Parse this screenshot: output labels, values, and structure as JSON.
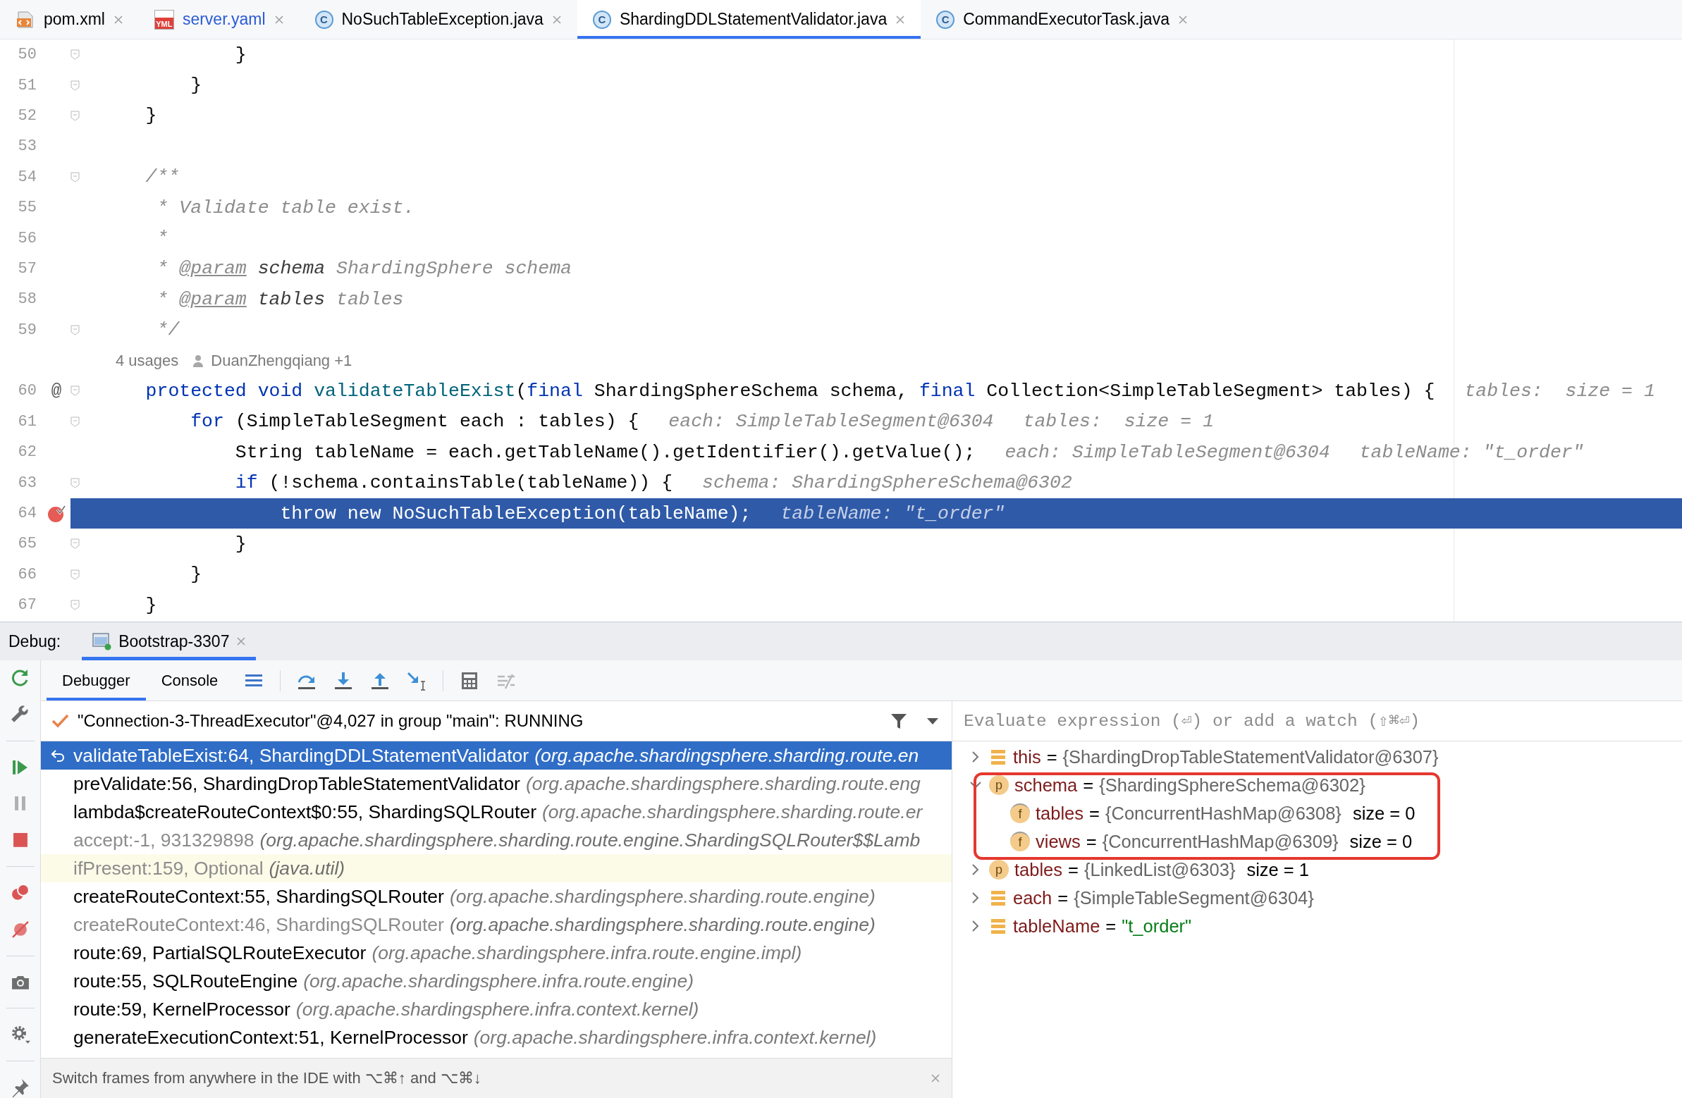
{
  "tabs": [
    {
      "label": "pom.xml",
      "kind": "xml",
      "selected": false,
      "color": "#000000"
    },
    {
      "label": "server.yaml",
      "kind": "yaml",
      "icon_text": "YML",
      "selected": false,
      "color": "#2a5bd7"
    },
    {
      "label": "NoSuchTableException.java",
      "kind": "class",
      "icon_text": "C",
      "selected": false,
      "color": "#000000"
    },
    {
      "label": "ShardingDDLStatementValidator.java",
      "kind": "class",
      "icon_text": "C",
      "selected": true,
      "color": "#000000"
    },
    {
      "label": "CommandExecutorTask.java",
      "kind": "class",
      "icon_text": "C",
      "selected": false,
      "color": "#000000"
    }
  ],
  "editor": {
    "lines": [
      {
        "kind": "code",
        "number": "50",
        "fold": true,
        "breakpoint": false,
        "current": false,
        "tokens": [
          {
            "kind": "plain",
            "text": "            }"
          }
        ]
      },
      {
        "kind": "code",
        "number": "51",
        "fold": true,
        "breakpoint": false,
        "current": false,
        "tokens": [
          {
            "kind": "plain",
            "text": "        }"
          }
        ]
      },
      {
        "kind": "code",
        "number": "52",
        "fold": true,
        "breakpoint": false,
        "current": false,
        "tokens": [
          {
            "kind": "plain",
            "text": "    }"
          }
        ]
      },
      {
        "kind": "code",
        "number": "53",
        "fold": false,
        "breakpoint": false,
        "current": false
      },
      {
        "kind": "code",
        "number": "54",
        "fold": true,
        "breakpoint": false,
        "current": false,
        "tokens": [
          {
            "kind": "comment",
            "text": "    /**"
          }
        ]
      },
      {
        "kind": "code",
        "number": "55",
        "fold": false,
        "breakpoint": false,
        "current": false,
        "tokens": [
          {
            "kind": "comment",
            "text": "     * Validate table exist."
          }
        ]
      },
      {
        "kind": "code",
        "number": "56",
        "fold": false,
        "breakpoint": false,
        "current": false,
        "tokens": [
          {
            "kind": "comment",
            "text": "     *"
          }
        ]
      },
      {
        "kind": "code",
        "number": "57",
        "fold": false,
        "breakpoint": false,
        "current": false,
        "tokens": [
          {
            "kind": "comment",
            "text": "     * "
          },
          {
            "kind": "doctag",
            "text": "@param"
          },
          {
            "kind": "docparam",
            "text": " schema"
          },
          {
            "kind": "comment",
            "text": " ShardingSphere schema"
          }
        ]
      },
      {
        "kind": "code",
        "number": "58",
        "fold": false,
        "breakpoint": false,
        "current": false,
        "tokens": [
          {
            "kind": "comment",
            "text": "     * "
          },
          {
            "kind": "doctag",
            "text": "@param"
          },
          {
            "kind": "docparam",
            "text": " tables"
          },
          {
            "kind": "comment",
            "text": " tables"
          }
        ]
      },
      {
        "kind": "code",
        "number": "59",
        "fold": true,
        "breakpoint": false,
        "current": false,
        "tokens": [
          {
            "kind": "comment",
            "text": "     */"
          }
        ]
      },
      {
        "kind": "inlay",
        "usages": "4 usages",
        "author": "DuanZhengqiang +1"
      },
      {
        "kind": "code",
        "number": "60",
        "gutter_text": "@",
        "fold": true,
        "breakpoint": false,
        "current": false,
        "tokens": [
          {
            "kind": "keyword",
            "text": "    protected void "
          },
          {
            "kind": "decl",
            "text": "validateTableExist"
          },
          {
            "kind": "plain",
            "text": "("
          },
          {
            "kind": "keyword",
            "text": "final"
          },
          {
            "kind": "plain",
            "text": " ShardingSphereSchema schema, "
          },
          {
            "kind": "keyword",
            "text": "final"
          },
          {
            "kind": "plain",
            "text": " Collection<SimpleTableSegment> tables) {"
          }
        ],
        "hints": [
          "tables:  size = 1"
        ]
      },
      {
        "kind": "code",
        "number": "61",
        "fold": true,
        "breakpoint": false,
        "current": false,
        "tokens": [
          {
            "kind": "keyword",
            "text": "        for"
          },
          {
            "kind": "plain",
            "text": " (SimpleTableSegment each : tables) {"
          }
        ],
        "hints": [
          "each: SimpleTableSegment@6304",
          "tables:  size = 1"
        ]
      },
      {
        "kind": "code",
        "number": "62",
        "fold": false,
        "breakpoint": false,
        "current": false,
        "tokens": [
          {
            "kind": "plain",
            "text": "            String tableName = each.getTableName().getIdentifier().getValue();"
          }
        ],
        "hints": [
          "each: SimpleTableSegment@6304",
          "tableName: \"t_order\""
        ]
      },
      {
        "kind": "code",
        "number": "63",
        "fold": true,
        "breakpoint": false,
        "current": false,
        "tokens": [
          {
            "kind": "keyword",
            "text": "            if"
          },
          {
            "kind": "plain",
            "text": " (!schema.containsTable(tableName)) {"
          }
        ],
        "hints": [
          "schema: ShardingSphereSchema@6302"
        ]
      },
      {
        "kind": "code",
        "number": "64",
        "fold": false,
        "breakpoint": true,
        "current": true,
        "tokens": [
          {
            "kind": "keyword",
            "text": "                throw new"
          },
          {
            "kind": "plain",
            "text": " NoSuchTableException(tableName);"
          }
        ],
        "hints": [
          "tableName: \"t_order\""
        ]
      },
      {
        "kind": "code",
        "number": "65",
        "fold": true,
        "breakpoint": false,
        "current": false,
        "tokens": [
          {
            "kind": "plain",
            "text": "            }"
          }
        ]
      },
      {
        "kind": "code",
        "number": "66",
        "fold": true,
        "breakpoint": false,
        "current": false,
        "tokens": [
          {
            "kind": "plain",
            "text": "        }"
          }
        ]
      },
      {
        "kind": "code",
        "number": "67",
        "fold": true,
        "breakpoint": false,
        "current": false,
        "tokens": [
          {
            "kind": "plain",
            "text": "    }"
          }
        ]
      }
    ]
  },
  "debug": {
    "label": "Debug:",
    "session": {
      "label": "Bootstrap-3307",
      "selected": true
    },
    "tabs": [
      {
        "label": "Debugger",
        "selected": true
      },
      {
        "label": "Console",
        "selected": false
      }
    ],
    "thread": "\"Connection-3-ThreadExecutor\"@4,027 in group \"main\": RUNNING",
    "frames": [
      {
        "method": "validateTableExist:64, ShardingDDLStatementValidator",
        "package": "(org.apache.shardingsphere.sharding.route.en",
        "selected": true,
        "kind": "normal"
      },
      {
        "method": "preValidate:56, ShardingDropTableStatementValidator",
        "package": "(org.apache.shardingsphere.sharding.route.eng",
        "selected": false,
        "kind": "normal"
      },
      {
        "method": "lambda$createRouteContext$0:55, ShardingSQLRouter",
        "package": "(org.apache.shardingsphere.sharding.route.er",
        "selected": false,
        "kind": "normal"
      },
      {
        "method": "accept:-1, 931329898",
        "package": "(org.apache.shardingsphere.sharding.route.engine.ShardingSQLRouter$$Lamb",
        "selected": false,
        "kind": "dimmed"
      },
      {
        "method": "ifPresent:159, Optional",
        "package": "(java.util)",
        "selected": false,
        "kind": "library"
      },
      {
        "method": "createRouteContext:55, ShardingSQLRouter",
        "package": "(org.apache.shardingsphere.sharding.route.engine)",
        "selected": false,
        "kind": "normal"
      },
      {
        "method": "createRouteContext:46, ShardingSQLRouter",
        "package": "(org.apache.shardingsphere.sharding.route.engine)",
        "selected": false,
        "kind": "dimmed"
      },
      {
        "method": "route:69, PartialSQLRouteExecutor",
        "package": "(org.apache.shardingsphere.infra.route.engine.impl)",
        "selected": false,
        "kind": "normal"
      },
      {
        "method": "route:55, SQLRouteEngine",
        "package": "(org.apache.shardingsphere.infra.route.engine)",
        "selected": false,
        "kind": "normal"
      },
      {
        "method": "route:59, KernelProcessor",
        "package": "(org.apache.shardingsphere.infra.context.kernel)",
        "selected": false,
        "kind": "normal"
      },
      {
        "method": "generateExecutionContext:51, KernelProcessor",
        "package": "(org.apache.shardingsphere.infra.context.kernel)",
        "selected": false,
        "kind": "normal"
      }
    ],
    "tip": "Switch frames from anywhere in the IDE with ⌥⌘↑ and ⌥⌘↓",
    "evaluate": {
      "placeholder": "Evaluate expression (⏎) or add a watch (⇧⌘⏎)"
    },
    "variables": [
      {
        "kind": "local",
        "name": "this",
        "separator": "=",
        "value": "{ShardingDropTableStatementValidator@6307}",
        "expanded": false
      },
      {
        "kind": "param",
        "badge": "p",
        "name": "schema",
        "separator": "=",
        "value": "{ShardingSphereSchema@6302}",
        "expanded": true,
        "annotated": true,
        "children": [
          {
            "kind": "field",
            "badge": "f",
            "name": "tables",
            "separator": "=",
            "value": "{ConcurrentHashMap@6308}",
            "extra": "size = 0"
          },
          {
            "kind": "field",
            "badge": "f",
            "name": "views",
            "separator": "=",
            "value": "{ConcurrentHashMap@6309}",
            "extra": "size = 0"
          }
        ]
      },
      {
        "kind": "param",
        "badge": "p",
        "name": "tables",
        "separator": "=",
        "value": "{LinkedList@6303}",
        "extra": "size = 1",
        "expanded": false,
        "annotated": false
      },
      {
        "kind": "local",
        "name": "each",
        "separator": "=",
        "value": "{SimpleTableSegment@6304}",
        "expanded": false
      },
      {
        "kind": "local",
        "name": "tableName",
        "separator": "=",
        "value": "\"t_order\"",
        "color": "#067d17",
        "expanded": false
      }
    ]
  }
}
